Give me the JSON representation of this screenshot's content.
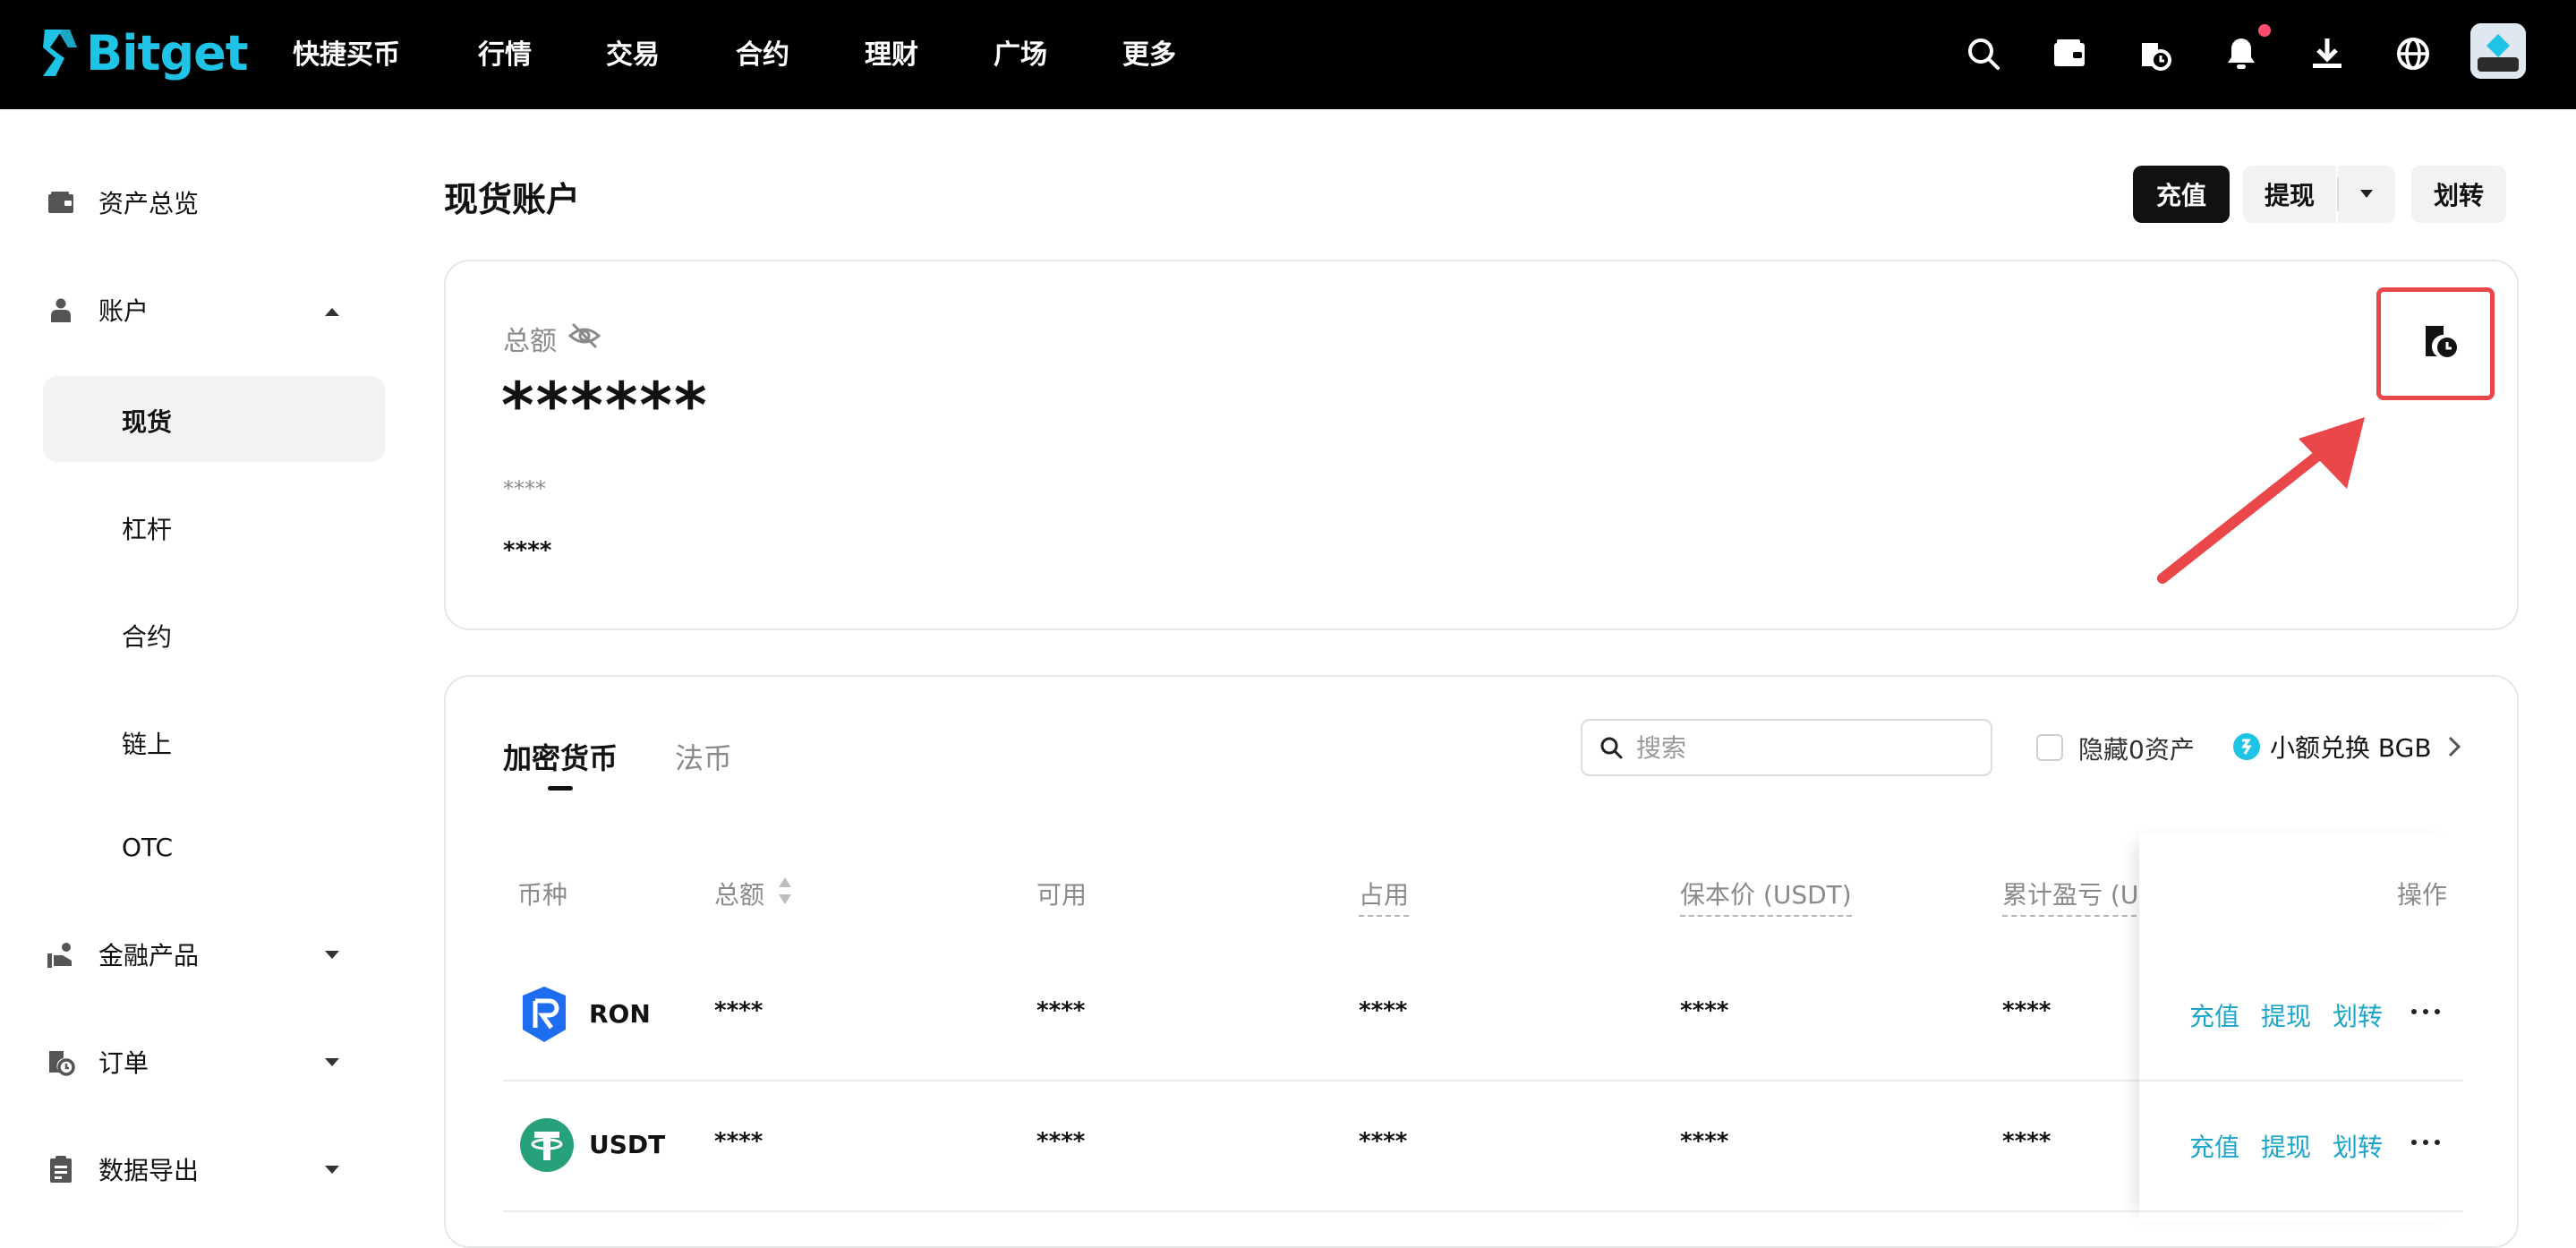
{
  "brand": {
    "name": "Bitget",
    "accent": "#1ec3e6"
  },
  "nav": {
    "items": [
      "快捷买币",
      "行情",
      "交易",
      "合约",
      "理财",
      "广场",
      "更多"
    ],
    "icons": [
      "search-icon",
      "wallet-icon",
      "asset-history-icon",
      "bell-icon",
      "download-icon",
      "globe-icon"
    ]
  },
  "sidebar": {
    "items": [
      {
        "label": "资产总览",
        "icon": "wallet-icon"
      },
      {
        "label": "账户",
        "icon": "user-icon",
        "expanded": true
      },
      {
        "label": "金融产品",
        "icon": "finance-icon"
      },
      {
        "label": "订单",
        "icon": "order-icon"
      },
      {
        "label": "数据导出",
        "icon": "clipboard-icon"
      }
    ],
    "account_sub": [
      "现货",
      "杠杆",
      "合约",
      "链上",
      "OTC"
    ],
    "active": "现货"
  },
  "header": {
    "title": "现货账户",
    "deposit_label": "充值",
    "withdraw_label": "提现",
    "transfer_label": "划转"
  },
  "summary": {
    "total_label": "总额",
    "total_value": "******",
    "sub_value_1": "****",
    "sub_value_2": "****"
  },
  "assets": {
    "tabs": [
      "加密货币",
      "法币"
    ],
    "active_tab": "加密货币",
    "search_placeholder": "搜索",
    "hide_zero_label": "隐藏0资产",
    "convert_label": "小额兑换 BGB",
    "columns": [
      "币种",
      "总额",
      "可用",
      "占用",
      "保本价 (USDT)",
      "累计盈亏 (US",
      "操作"
    ],
    "rows": [
      {
        "coin": "RON",
        "total": "****",
        "available": "****",
        "occupied": "****",
        "breakeven": "****",
        "pnl": "****"
      },
      {
        "coin": "USDT",
        "total": "****",
        "available": "****",
        "occupied": "****",
        "breakeven": "****",
        "pnl": "****"
      }
    ],
    "actions": [
      "充值",
      "提现",
      "划转"
    ],
    "more_icon": "more-dots-icon"
  },
  "annotation": {
    "color": "#e9474a"
  }
}
